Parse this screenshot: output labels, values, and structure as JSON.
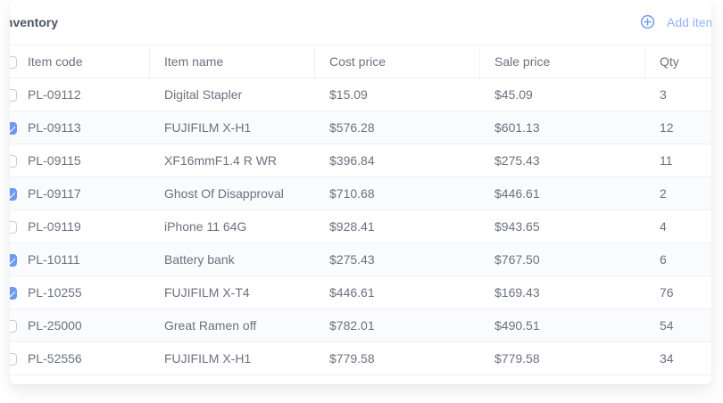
{
  "header": {
    "title": "Inventory",
    "add_label": "Add item",
    "add_icon": "plus-circle-icon",
    "accent_color": "#6d99f2"
  },
  "table": {
    "columns": [
      "Item code",
      "Item name",
      "Cost price",
      "Sale price",
      "Qty"
    ],
    "rows": [
      {
        "checked": false,
        "code": "PL-09112",
        "name": "Digital Stapler",
        "cost": "$15.09",
        "sale": "$45.09",
        "qty": "3"
      },
      {
        "checked": true,
        "code": "PL-09113",
        "name": "FUJIFILM X-H1",
        "cost": "$576.28",
        "sale": "$601.13",
        "qty": "12"
      },
      {
        "checked": false,
        "code": "PL-09115",
        "name": "XF16mmF1.4 R WR",
        "cost": "$396.84",
        "sale": "$275.43",
        "qty": "11"
      },
      {
        "checked": true,
        "code": "PL-09117",
        "name": "Ghost Of Disapproval",
        "cost": "$710.68",
        "sale": "$446.61",
        "qty": "2"
      },
      {
        "checked": false,
        "code": "PL-09119",
        "name": "iPhone 11 64G",
        "cost": "$928.41",
        "sale": "$943.65",
        "qty": "4"
      },
      {
        "checked": true,
        "code": "PL-10111",
        "name": "Battery bank",
        "cost": "$275.43",
        "sale": "$767.50",
        "qty": "6"
      },
      {
        "checked": true,
        "code": "PL-10255",
        "name": "FUJIFILM X-T4",
        "cost": "$446.61",
        "sale": "$169.43",
        "qty": "76"
      },
      {
        "checked": false,
        "code": "PL-25000",
        "name": "Great Ramen off",
        "cost": "$782.01",
        "sale": "$490.51",
        "qty": "54"
      },
      {
        "checked": false,
        "code": "PL-52556",
        "name": "FUJIFILM X-H1",
        "cost": "$779.58",
        "sale": "$779.58",
        "qty": "34"
      }
    ]
  }
}
